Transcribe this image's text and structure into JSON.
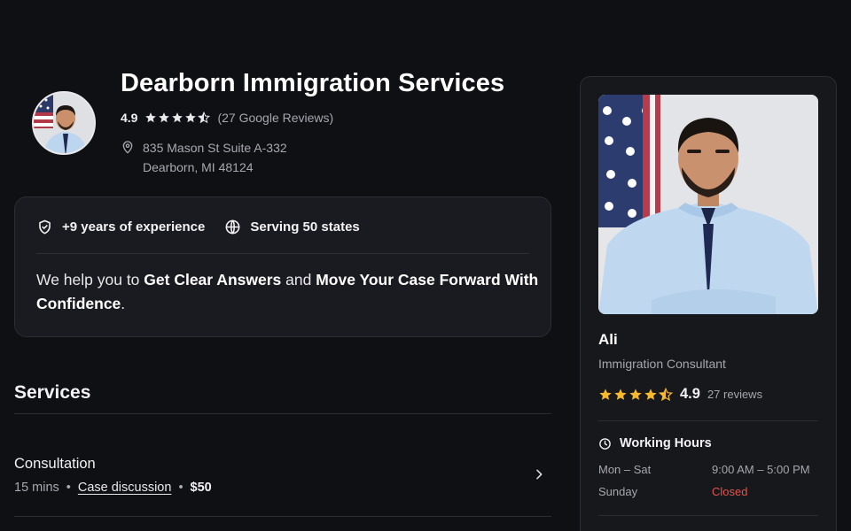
{
  "business": {
    "name": "Dearborn Immigration Services",
    "rating": "4.9",
    "reviews": "(27 Google Reviews)",
    "address_line1": "835 Mason St Suite A-332",
    "address_line2": "Dearborn, MI 48124"
  },
  "highlights": {
    "experience": "+9 years of experience",
    "serving": "Serving 50 states",
    "tagline_1": "We help you to ",
    "tagline_bold_1": "Get Clear Answers",
    "tagline_2": " and ",
    "tagline_bold_2": "Move Your Case Forward With Confidence",
    "tagline_3": "."
  },
  "services": {
    "title": "Services",
    "items": [
      {
        "name": "Consultation",
        "duration": "15 mins",
        "type": "Case discussion",
        "price": "$50"
      }
    ]
  },
  "profile": {
    "name": "Ali",
    "role": "Immigration Consultant",
    "rating": "4.9",
    "star_rating": 4.5,
    "reviews": "27 reviews",
    "hours_title": "Working Hours",
    "hours": [
      {
        "days": "Mon – Sat",
        "time": "9:00 AM – 5:00 PM"
      },
      {
        "days": "Sunday",
        "time": "Closed"
      }
    ]
  },
  "colors": {
    "background": "#0f1014",
    "card": "#1a1b20",
    "star_gold": "#f5b82e",
    "closed_red": "#e5534b"
  },
  "icons": [
    "location-pin-icon",
    "shield-check-icon",
    "globe-icon",
    "chevron-right-icon",
    "clock-icon",
    "star-icon"
  ]
}
